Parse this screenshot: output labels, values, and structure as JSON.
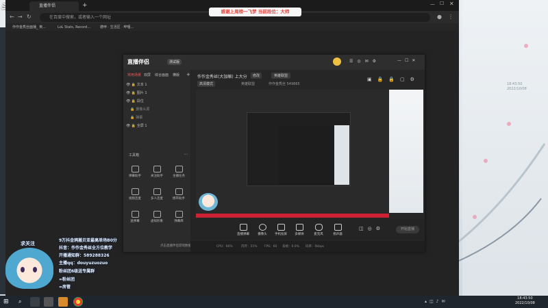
{
  "watermark": "斗鱼",
  "watermark_sub": "DOUYU.COM",
  "chrome": {
    "tab1_label": "直播伴侣",
    "omnibox_placeholder": "在百度中搜索，或者输入一个网址",
    "bookmarks": [
      "作作金秀丝面播_ 英...",
      "LoL Stats, Record...",
      "德甲 · 生活区 · 哔哩..."
    ]
  },
  "banner": "感谢上周榜一飞梦 当前段位：大师",
  "app": {
    "brand": "直播伴侣",
    "version_badge": "测试版",
    "left_tabs": [
      "常用场景",
      "双屏",
      "综合画面",
      "横版"
    ],
    "layers": [
      "文本 1",
      "图片 1",
      "段位",
      "摄像头源",
      "弹幕",
      "全屏 1"
    ],
    "toolbox_title": "工具箱",
    "tools": [
      "弹幕助手",
      "关注助手",
      "主播任务",
      "视频连麦",
      "多人连麦",
      "携带助手",
      "送弹幕",
      "虚拟形象",
      "弹幕库"
    ],
    "game_notice": "点击直播伴侣游戏数据",
    "room_title": "作作金秀丝(大加嘛) 上大分",
    "edit_label": "修改",
    "category": "英雄联盟",
    "mode_label": "高清模式",
    "room_category": "英雄联盟",
    "room_id": "作作金秀丝 549865",
    "bottom_tools": [
      "直播弹幕",
      "摄像头",
      "手机投屏",
      "多媒体",
      "麦克风",
      "扬声器"
    ],
    "start_button": "开始直播",
    "status_items": [
      "CPU：66%",
      "内存：51%",
      "FPS：60",
      "丢帧：0.0%",
      "码率：0kbps"
    ]
  },
  "overlay": {
    "fans": "求关注",
    "line1": "9万抖金鸦搬贝亚最高单场B0分",
    "line2": "抖音：作作金秀丝全方位教学",
    "line3": "开播通知群：589288326",
    "line4": "主播qq：douyuzuozuo",
    "line5": "粉丝团6级送专属群",
    "line6": "=粉丝团",
    "line7": "=房管"
  },
  "taskbar": {
    "time": "18:43:50",
    "date": "2022/10/08"
  }
}
